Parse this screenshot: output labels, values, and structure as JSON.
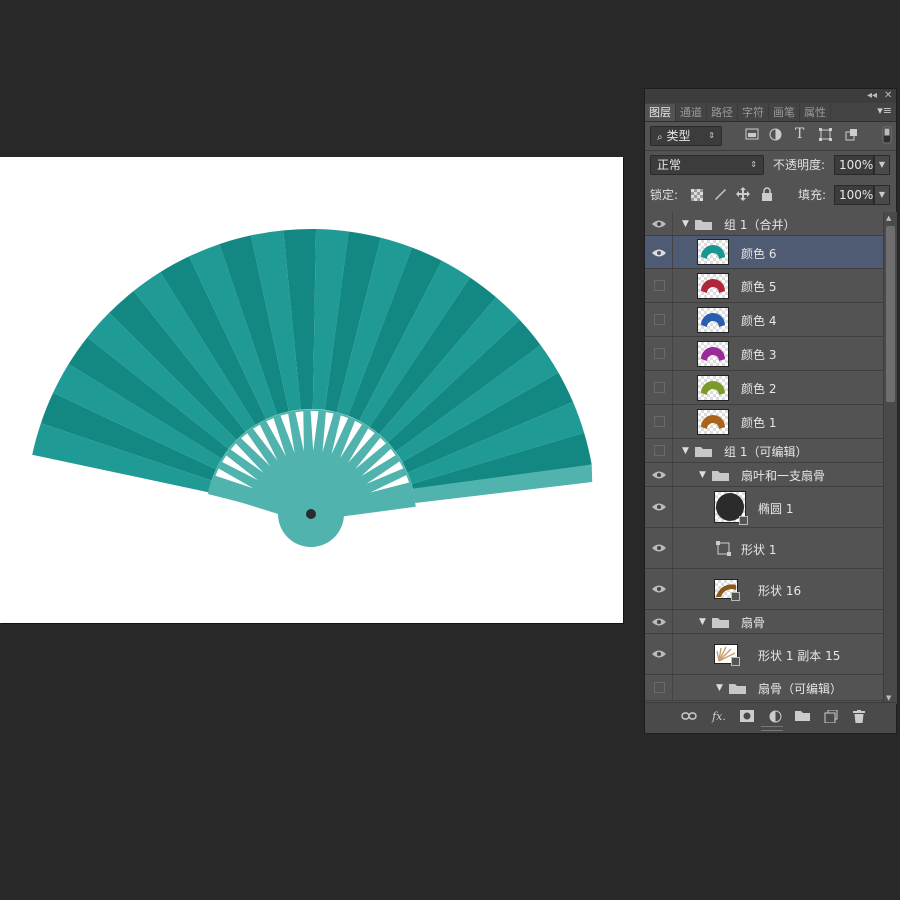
{
  "colors": {
    "background": "#282828",
    "fan_main": "#1a9690",
    "fan_stripe_light": "#1f9a94",
    "fan_stripe_dark": "#138882",
    "fan_inner": "#51b3ae",
    "rib": "#ffffff",
    "pivot": "#2b2b2b",
    "panel_bg": "#535353",
    "selection": "#4f5a73"
  },
  "panel": {
    "collapse_label": "◂◂",
    "close_label": "✕",
    "tabs": [
      {
        "label": "图层",
        "active": true
      },
      {
        "label": "通道",
        "active": false
      },
      {
        "label": "路径",
        "active": false
      },
      {
        "label": "字符",
        "active": false
      },
      {
        "label": "画笔",
        "active": false
      },
      {
        "label": "属性",
        "active": false
      }
    ],
    "menu_icon": "panel-menu-icon",
    "filter": {
      "value": "类型",
      "icons": [
        "image-filter-icon",
        "adjustment-filter-icon",
        "type-filter-icon",
        "shape-filter-icon",
        "smart-object-filter-icon"
      ]
    },
    "blend_mode": "正常",
    "opacity_label": "不透明度:",
    "opacity_value": "100%",
    "lock_label": "锁定:",
    "lock_icons": [
      "lock-transparent-icon",
      "lock-paint-icon",
      "lock-move-icon",
      "lock-all-icon"
    ],
    "fill_label": "填充:",
    "fill_value": "100%",
    "layers": [
      {
        "name": "组 1（合并）",
        "type": "group",
        "visible": true,
        "expanded": true,
        "depth": 0
      },
      {
        "name": "颜色 6",
        "type": "layer",
        "visible": true,
        "selected": true,
        "thumb_color": "#1a9690",
        "depth": 1
      },
      {
        "name": "颜色 5",
        "type": "layer",
        "visible": false,
        "thumb_color": "#b0263a",
        "depth": 1
      },
      {
        "name": "颜色 4",
        "type": "layer",
        "visible": false,
        "thumb_color": "#2a5db0",
        "depth": 1
      },
      {
        "name": "颜色 3",
        "type": "layer",
        "visible": false,
        "thumb_color": "#9a2a9a",
        "depth": 1
      },
      {
        "name": "颜色 2",
        "type": "layer",
        "visible": false,
        "thumb_color": "#7a9a2a",
        "depth": 1
      },
      {
        "name": "颜色 1",
        "type": "layer",
        "visible": false,
        "thumb_color": "#a8641c",
        "depth": 1
      },
      {
        "name": "组 1（可编辑）",
        "type": "group",
        "visible": false,
        "expanded": true,
        "depth": 0
      },
      {
        "name": "扇叶和一支扇骨",
        "type": "group",
        "visible": true,
        "expanded": true,
        "depth": 1
      },
      {
        "name": "椭圆 1",
        "type": "shape",
        "visible": true,
        "thumb_color": "#2b2b2b",
        "depth": 2
      },
      {
        "name": "形状 1",
        "type": "shape-empty",
        "visible": true,
        "depth": 2
      },
      {
        "name": "形状 16",
        "type": "shape",
        "visible": true,
        "thumb_color": "#8a5a1a",
        "depth": 2
      },
      {
        "name": "扇骨",
        "type": "group",
        "visible": true,
        "expanded": true,
        "depth": 1
      },
      {
        "name": "形状 1 副本 15",
        "type": "shape",
        "visible": true,
        "thumb_color": "#c8a070",
        "depth": 2
      },
      {
        "name": "扇骨（可编辑）",
        "type": "group",
        "visible": false,
        "expanded": true,
        "depth": 2
      }
    ],
    "footer_icons": [
      "link-layers-icon",
      "fx-icon",
      "add-mask-icon",
      "adjustment-layer-icon",
      "new-group-icon",
      "new-layer-icon",
      "delete-layer-icon"
    ],
    "footer_fx_label": "fx."
  }
}
